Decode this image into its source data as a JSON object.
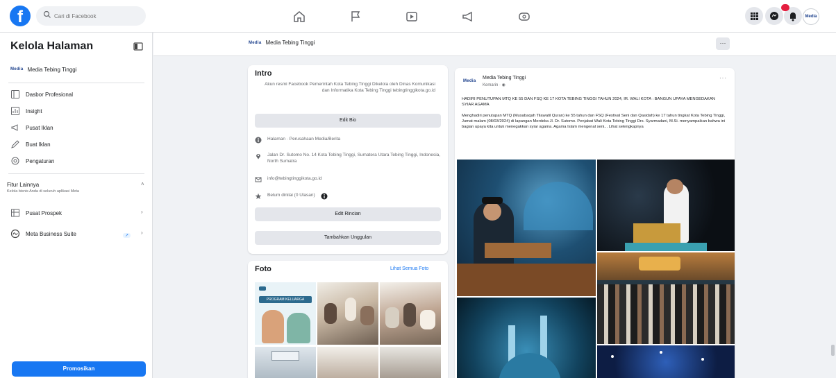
{
  "topbar": {
    "search_placeholder": "Cari di Facebook",
    "nav_icons": [
      "home-icon",
      "flag-icon",
      "video-icon",
      "megaphone-icon",
      "gaming-icon"
    ],
    "right_icons": [
      "menu-grid-icon",
      "messenger-icon",
      "bell-icon"
    ],
    "avatar_text": "Media"
  },
  "sidebar": {
    "title": "Kelola Halaman",
    "page_name": "Media Tebing Tinggi",
    "brand": "Media",
    "items": [
      {
        "label": "Dasbor Profesional",
        "icon": "dashboard-icon"
      },
      {
        "label": "Insight",
        "icon": "insight-icon"
      },
      {
        "label": "Pusat Iklan",
        "icon": "megaphone-icon"
      },
      {
        "label": "Buat Iklan",
        "icon": "pencil-icon"
      },
      {
        "label": "Pengaturan",
        "icon": "gear-icon"
      }
    ],
    "section_title": "Fitur Lainnya",
    "section_sub": "Kelola bisnis Anda di seluruh aplikasi Meta",
    "more_items": [
      {
        "label": "Pusat Prospek",
        "icon": "prospect-icon"
      },
      {
        "label": "Meta Business Suite",
        "icon": "meta-icon"
      }
    ],
    "cta": "Promosikan"
  },
  "pagebar": {
    "brand": "Media",
    "page_name": "Media Tebing Tinggi",
    "more": "⋯"
  },
  "intro": {
    "title": "Intro",
    "bio": "Akun resmi Facebook Pemerintah Kota Tebing Tinggi Dikelola oleh Dinas Komunikasi dan Informatika Kota Tebing Tinggi tebingtinggikota.go.id",
    "edit_bio": "Edit Bio",
    "category": "Halaman · Perusahaan Media/Berita",
    "address": "Jalan Dr. Sutomo No. 14 Kota Tebing Tinggi, Sumatera Utara Tebing Tinggi, Indonesia, North Sumatra",
    "email": "info@tebingtinggikota.go.id",
    "rating": "Belum dinilai (0 Ulasan)",
    "edit_details": "Edit Rincian",
    "add_featured": "Tambahkan Unggulan"
  },
  "photos": {
    "title": "Foto",
    "see_all": "Lihat Semua Foto",
    "thumb_caption": "PROGRAM KELUARGA"
  },
  "post": {
    "brand": "Media",
    "author": "Media Tebing Tinggi",
    "time": "Kemarin · ◉",
    "menu": "···",
    "headline": "HADIRI PENUTUPAN MTQ KE 55 DAN FSQ KE 17 KOTA TEBING TINGGI TAHUN 2024, IR. WALI KOTA : BANGUN UPAYA MENGEDAKAN SYIAR AGAMA",
    "body": "Menghadiri penutupan MTQ (Musabaqah Tilawatil Quran) ke 55 tahun dan FSQ (Festival Seni dan Qasidah) ke 17 tahun tingkat Kota Tebing Tinggi, Jumat malam (08/03/2024) di lapangan Merdeka Jl. Dr. Sutomo. Penjabat Wali Kota Tebing Tinggi Drs. Syarmadani, M.Si. menyampaikan bahwa ini bagian upaya kita untuk menegakkan syiar agama. Agama Islam mengenal seni... Lihat selengkapnya"
  },
  "colors": {
    "brand_blue": "#1877f2",
    "page_bg": "#f0f2f5",
    "notification_red": "#e41e3f"
  }
}
